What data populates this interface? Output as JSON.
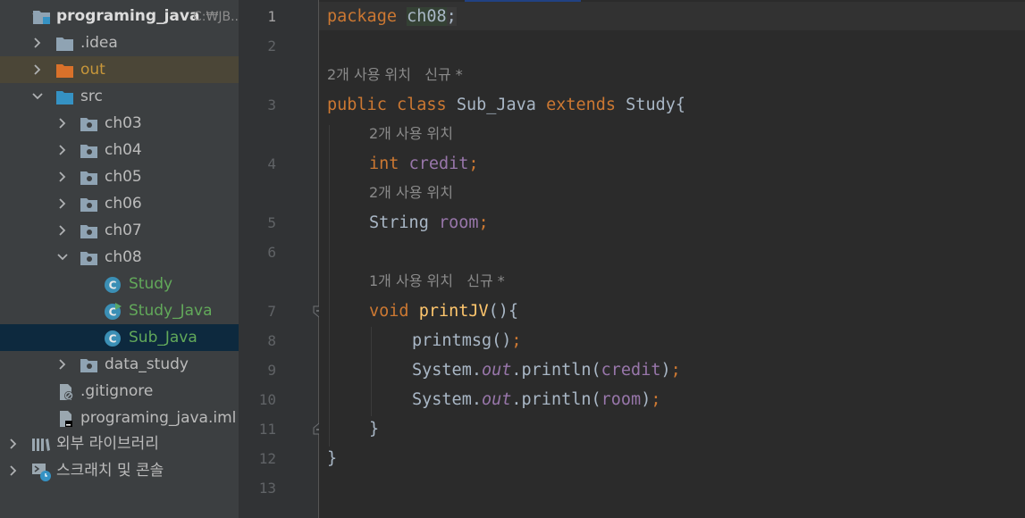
{
  "project_tree": {
    "project": {
      "name": "programing_java",
      "path": "C:₩JB..."
    },
    "idea": ".idea",
    "out": "out",
    "src": "src",
    "folders": [
      "ch03",
      "ch04",
      "ch05",
      "ch06",
      "ch07",
      "ch08"
    ],
    "ch08_files": [
      "Study",
      "Study_Java",
      "Sub_Java"
    ],
    "data_study": "data_study",
    "gitignore": ".gitignore",
    "iml": "programing_java.iml",
    "external_libs": "외부 라이브러리",
    "scratches": "스크래치 및 콘솔"
  },
  "colors": {
    "tree_bg": "#3c3f41",
    "editor_bg": "#2b2b2b",
    "keyword": "#cc7832",
    "field": "#9876aa",
    "method": "#ffc66d",
    "selected_row": "#0d293e"
  },
  "editor": {
    "line_numbers": [
      "1",
      "2",
      "3",
      "4",
      "5",
      "6",
      "7",
      "8",
      "9",
      "10",
      "11",
      "12",
      "13"
    ],
    "hints": {
      "class_usage": "2개 사용 위치",
      "class_new": "신규 *",
      "credit_usage": "2개 사용 위치",
      "room_usage": "2개 사용 위치",
      "method_usage": "1개 사용 위치",
      "method_new": "신규 *"
    },
    "code": {
      "kw_package": "package",
      "pkg_name": "ch08",
      "semi": ";",
      "kw_public": "public",
      "kw_class": "class",
      "class_name": "Sub_Java",
      "kw_extends": "extends",
      "super_name": "Study",
      "brace_open": "{",
      "kw_int": "int",
      "fld_credit": "credit",
      "type_string": "String",
      "fld_room": "room",
      "kw_void": "void",
      "method_name": "printJV",
      "parens_brace": "(){",
      "call_printmsg": "printmsg()",
      "sys": "System.",
      "out": "out",
      "println": ".println(",
      "close_paren": ")",
      "brace_close": "}"
    }
  }
}
